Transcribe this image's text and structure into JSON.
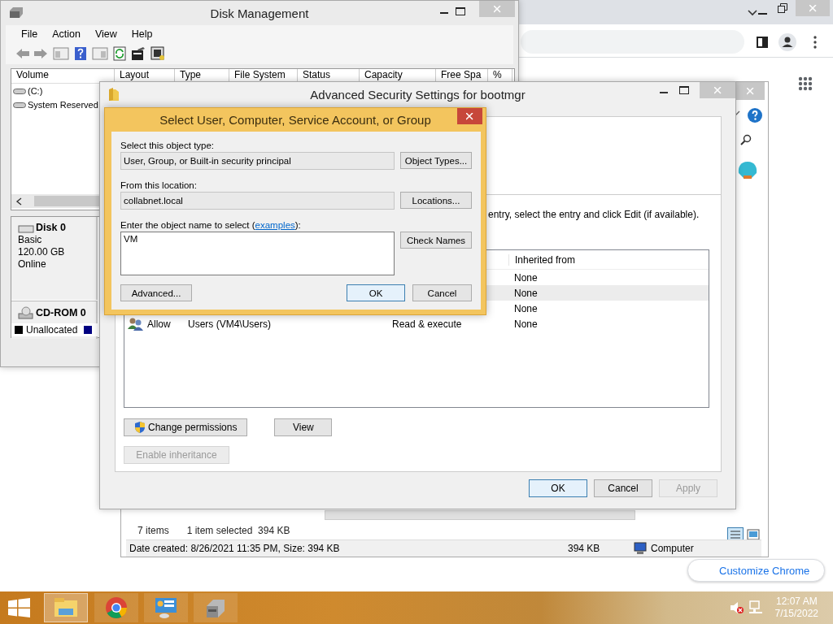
{
  "chrome_window": {
    "customize_button": "Customize Chrome"
  },
  "explorer_window": {
    "status_bar": {
      "item_count": "7 items",
      "selection": "1 item selected  394 KB"
    },
    "details_bar": {
      "info": "Date created: 8/26/2021 11:35 PM, Size: 394 KB",
      "size": "394 KB",
      "zone": "Computer"
    }
  },
  "disk_management": {
    "title": "Disk Management",
    "menu": [
      "File",
      "Action",
      "View",
      "Help"
    ],
    "columns": [
      "Volume",
      "Layout",
      "Type",
      "File System",
      "Status",
      "Capacity",
      "Free Spa",
      "%"
    ],
    "volumes": [
      "(C:)",
      "System Reserved"
    ],
    "disks": [
      {
        "kind": "disk",
        "name": "Disk 0",
        "details": [
          "Basic",
          "120.00 GB",
          "Online"
        ]
      },
      {
        "kind": "cdrom",
        "name": "CD-ROM 0"
      }
    ],
    "legend": [
      {
        "label": "Unallocated",
        "color": "#000000"
      },
      {
        "color": "#000080"
      }
    ]
  },
  "advanced_security": {
    "title": "Advanced Security Settings for bootmgr",
    "instruction": "entry, select the entry and click Edit (if available).",
    "table": {
      "columns": [
        "Inherited from"
      ],
      "rows": [
        {
          "inherited_from": "None",
          "selected": false
        },
        {
          "inherited_from": "None",
          "selected": true
        },
        {
          "inherited_from": "None",
          "selected": false
        },
        {
          "type": "Allow",
          "principal": "Users (VM4\\Users)",
          "access": "Read & execute",
          "inherited_from": "None",
          "selected": false
        }
      ]
    },
    "buttons": [
      {
        "label": "Change permissions",
        "kind": "shield",
        "disabled": false
      },
      {
        "label": "View",
        "kind": "plain",
        "disabled": false
      },
      {
        "label": "Enable inheritance",
        "kind": "plain",
        "disabled": true
      }
    ],
    "footer_buttons": [
      {
        "label": "OK",
        "default": true,
        "disabled": false
      },
      {
        "label": "Cancel",
        "default": false,
        "disabled": false
      },
      {
        "label": "Apply",
        "default": false,
        "disabled": true
      }
    ]
  },
  "select_dialog": {
    "title": "Select User, Computer, Service Account, or Group",
    "object_type_label": "Select this object type:",
    "object_type": "User, Group, or Built-in security principal",
    "object_types_button": "Object Types...",
    "location_label": "From this location:",
    "location": "collabnet.local",
    "locations_button": "Locations...",
    "name_label": {
      "before": "Enter the object name to select (",
      "link": "examples",
      "after": "):"
    },
    "name_value": "VM",
    "check_names_button": "Check Names",
    "advanced_button": "Advanced...",
    "ok_button": "OK",
    "cancel_button": "Cancel"
  },
  "taskbar": {
    "apps": [
      {
        "kind": "explorer",
        "selected": true
      },
      {
        "kind": "chrome",
        "selected": false
      },
      {
        "kind": "control-panel",
        "selected": false
      },
      {
        "kind": "disk-management",
        "selected": false
      }
    ],
    "clock": {
      "time": "12:07 AM",
      "date": "7/15/2022"
    }
  }
}
